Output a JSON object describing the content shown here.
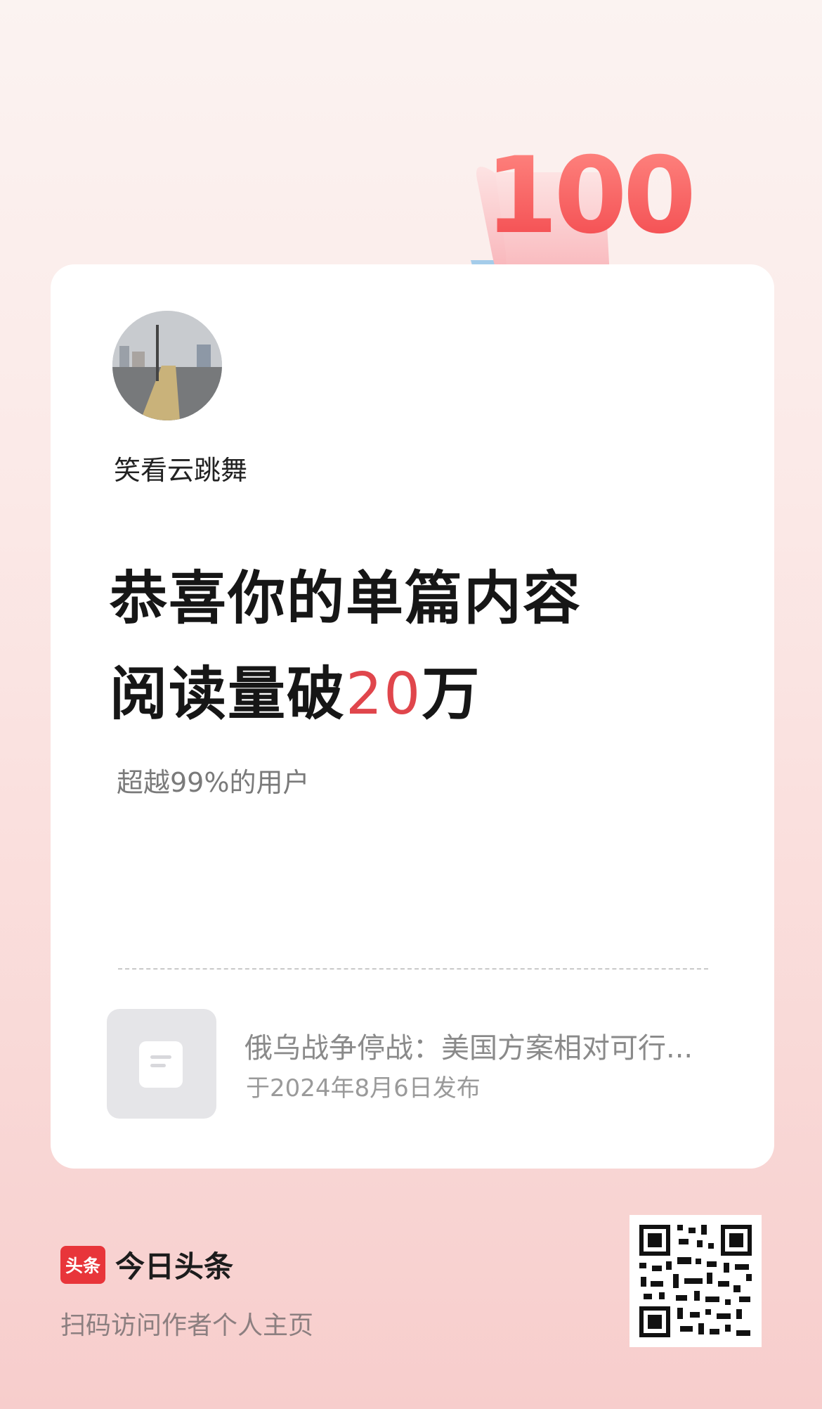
{
  "badge": {
    "number": "100"
  },
  "author": {
    "name": "笑看云跳舞"
  },
  "headline": {
    "line1": "恭喜你的单篇内容",
    "line2_prefix": "阅读量破",
    "line2_number": "20",
    "line2_suffix": "万"
  },
  "subtext": "超越99%的用户",
  "article": {
    "title": "俄乌战争停战：美国方案相对可行...",
    "date": "于2024年8月6日发布"
  },
  "brand": {
    "logo_text": "头条",
    "name": "今日头条",
    "scan_tip": "扫码访问作者个人主页"
  },
  "colors": {
    "accent": "#e0464c",
    "brand_red": "#e8353a"
  }
}
